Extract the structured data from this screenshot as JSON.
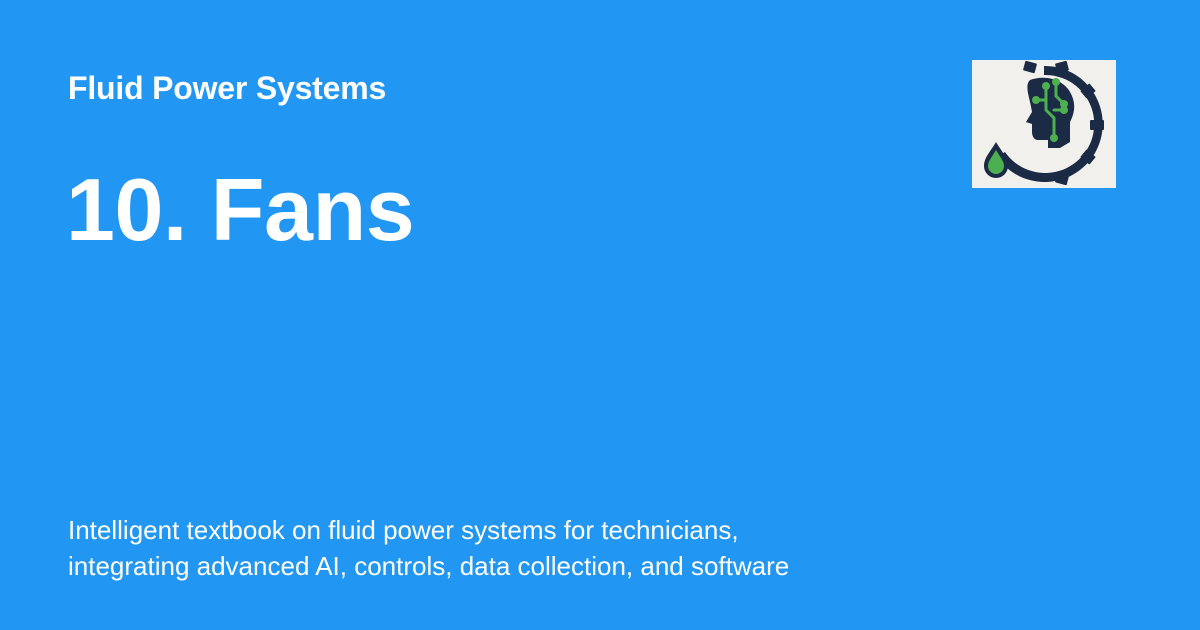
{
  "header": {
    "site_name": "Fluid Power Systems"
  },
  "main": {
    "title": "10. Fans",
    "description_lines": [
      "Intelligent textbook on fluid power systems for technicians,",
      "integrating advanced AI, controls, data collection, and software"
    ]
  },
  "logo": {
    "icon": "head-gear-droplet-logo"
  },
  "colors": {
    "background": "#2196f3",
    "text": "#ffffff",
    "logo_bg": "#f1f0ec",
    "logo_dark": "#1b2b45",
    "logo_green": "#4caf50"
  }
}
